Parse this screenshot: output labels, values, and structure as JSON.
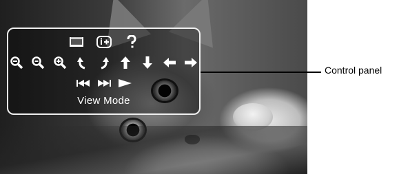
{
  "control_panel": {
    "top_icons": [
      {
        "name": "view-mode-icon"
      },
      {
        "name": "info-icon"
      },
      {
        "name": "help-icon"
      }
    ],
    "nav_icons": [
      {
        "name": "zoom-out-icon"
      },
      {
        "name": "zoom-reset-icon"
      },
      {
        "name": "zoom-in-icon"
      },
      {
        "name": "rotate-left-icon"
      },
      {
        "name": "rotate-right-icon"
      },
      {
        "name": "arrow-up-icon"
      },
      {
        "name": "arrow-down-icon"
      },
      {
        "name": "arrow-left-icon"
      },
      {
        "name": "arrow-right-icon"
      }
    ],
    "playback_icons": [
      {
        "name": "previous-icon"
      },
      {
        "name": "next-icon"
      },
      {
        "name": "play-icon"
      }
    ],
    "mode_label": "View Mode"
  },
  "callout": {
    "label": "Control panel"
  },
  "colors": {
    "icon": "#ffffff",
    "panel_border": "#f0f0f0",
    "callout_text": "#000000"
  }
}
